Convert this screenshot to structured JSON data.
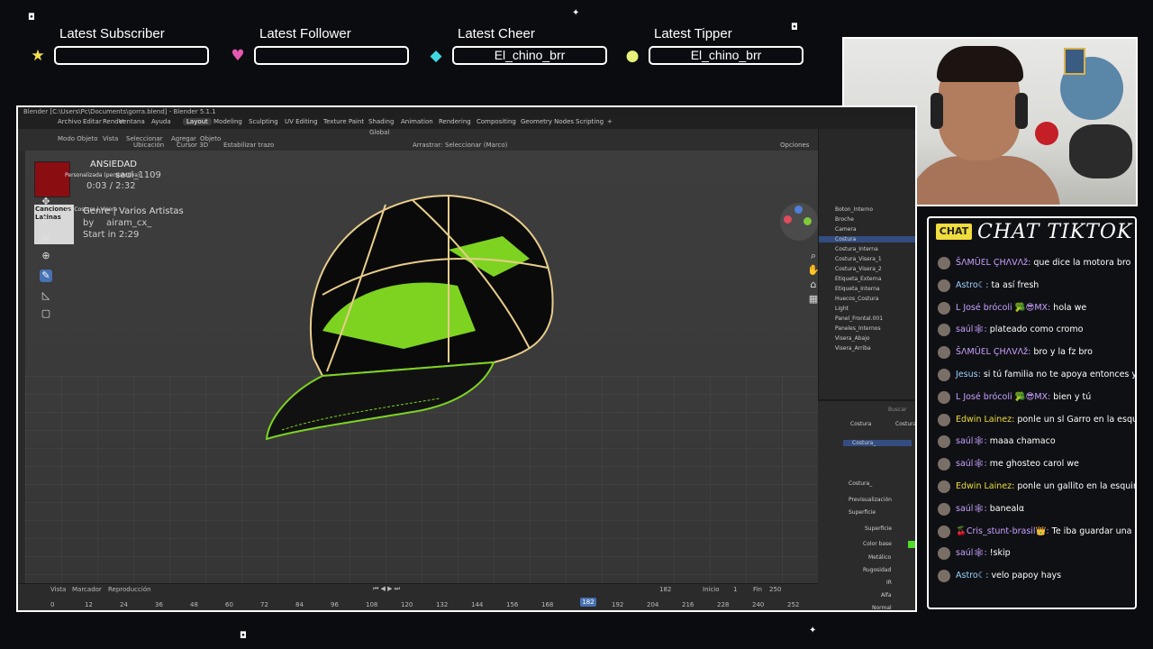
{
  "alerts": [
    {
      "label": "Latest Subscriber",
      "value": "",
      "icon": "star-icon",
      "color": "#f5e050"
    },
    {
      "label": "Latest Follower",
      "value": "",
      "icon": "heart-icon",
      "color": "#e458b0"
    },
    {
      "label": "Latest Cheer",
      "value": "El_chino_brr",
      "icon": "diamond-icon",
      "color": "#42d7e0"
    },
    {
      "label": "Latest Tipper",
      "value": "El_chino_brr",
      "icon": "coin-icon",
      "color": "#e6f07a"
    }
  ],
  "blender": {
    "title": "Blender [C:\\Users\\Pc\\Documents\\gorra.blend] - Blender 5.1.1",
    "menu": [
      "Archivo",
      "Editar",
      "Render",
      "Ventana",
      "Ayuda"
    ],
    "workspaces": [
      "Layout",
      "Modeling",
      "Sculpting",
      "UV Editing",
      "Texture Paint",
      "Shading",
      "Animation",
      "Rendering",
      "Compositing",
      "Geometry Nodes",
      "Scripting"
    ],
    "active_workspace": "Layout",
    "header": {
      "mode": "Modo Objeto",
      "view": "Vista",
      "select": "Seleccionar",
      "add": "Agregar",
      "object": "Objeto",
      "orientation": "Global",
      "pivot": "Ubicación",
      "cursor": "Cursor 3D",
      "snap_label": "Estabilizar trazo",
      "drag_label": "Arrastrar:",
      "drag_value": "Seleccionar (Marco)",
      "options": "Opciones"
    },
    "viewport_info": {
      "persp": "Personalizada (perspectiva)",
      "collection": "(2) Costura | Visera"
    },
    "song": {
      "title": "ANSIEDAD",
      "artist": "saul_1109",
      "time": "0:03 / 2:32",
      "playlist": "Canciones Latinas",
      "genre": "Genre | Varios Artistas",
      "by": "by",
      "user": "airam_cx_",
      "start": "Start in 2:29"
    },
    "outliner": [
      "Boton_Interno",
      "Broche",
      "Camera",
      "Costura",
      "Costura_Interna",
      "Costura_Visera_1",
      "Costura_Visera_2",
      "Etiqueta_Externa",
      "Etiqueta_Interna",
      "Huecos_Costura",
      "Light",
      "Panel_Frontal.001",
      "Paneles_Internos",
      "Visera_Abajo",
      "Visera_Arriba"
    ],
    "selected_object": "Costura",
    "properties": {
      "search": "Buscar",
      "breadcrumb1": "Costura",
      "breadcrumb2": "Costura",
      "material": "Costura_",
      "material_name": "Costura_",
      "preview": "Previsualización",
      "surface": "Superficie",
      "surface_label": "Superficie",
      "base_color": "Color base",
      "metallic": "Metálico",
      "roughness": "Rugosidad",
      "ior": "IR",
      "alpha": "Alfa",
      "normal": "Normal"
    },
    "timeline": {
      "view": "Vista",
      "marker": "Marcador",
      "playback": "Reproducción",
      "current": "182",
      "frame_display": "182",
      "start_label": "Inicio",
      "start": "1",
      "end_label": "Fin",
      "end": "250",
      "ticks": [
        "0",
        "12",
        "24",
        "36",
        "48",
        "60",
        "72",
        "84",
        "96",
        "108",
        "120",
        "132",
        "144",
        "156",
        "168",
        "182",
        "192",
        "204",
        "216",
        "228",
        "240",
        "252"
      ]
    }
  },
  "chat": {
    "badge": "CHAT",
    "title": "CHAT TIKTOK",
    "messages": [
      {
        "user": "ŠΛMŪƐL ÇHΛVΛž:",
        "text": "que dice la motora bro",
        "color": "#c9a2ff"
      },
      {
        "user": "Astro☾:",
        "text": "ta así fresh",
        "color": "#9ad4ff"
      },
      {
        "user": "L José brócoli 🥦😎MX:",
        "text": "hola we",
        "color": "#c9a2ff"
      },
      {
        "user": "saúl🕸:",
        "text": "plateado como cromo",
        "color": "#c9a2ff"
      },
      {
        "user": "ŠΛMŪƐL ÇHΛVΛž:",
        "text": "bro y la fz bro",
        "color": "#c9a2ff"
      },
      {
        "user": "Jesus:",
        "text": "si tú familia no te apoya entonces yo s",
        "color": "#9ad4ff"
      },
      {
        "user": "L José brócoli 🥦😎MX:",
        "text": "bien y tú",
        "color": "#c9a2ff"
      },
      {
        "user": "Edwin Lainez:",
        "text": "ponle un sl Garro en la esquina",
        "color": "#f0dc3c"
      },
      {
        "user": "saúl🕸:",
        "text": "maaa chamaco",
        "color": "#c9a2ff"
      },
      {
        "user": "saúl🕸:",
        "text": "me ghosteo carol we",
        "color": "#c9a2ff"
      },
      {
        "user": "Edwin Lainez:",
        "text": "ponle un gallito en la esquina c",
        "color": "#f0dc3c"
      },
      {
        "user": "saúl🕸:",
        "text": "banealα",
        "color": "#c9a2ff"
      },
      {
        "user": "🍒Cris_stunt-brasil👑:",
        "text": "Te iba guardar una ros",
        "color": "#c9a2ff"
      },
      {
        "user": "saúl🕸:",
        "text": "!skip",
        "color": "#c9a2ff"
      },
      {
        "user": "Astro☾:",
        "text": "velo papoy hays",
        "color": "#9ad4ff"
      }
    ]
  }
}
